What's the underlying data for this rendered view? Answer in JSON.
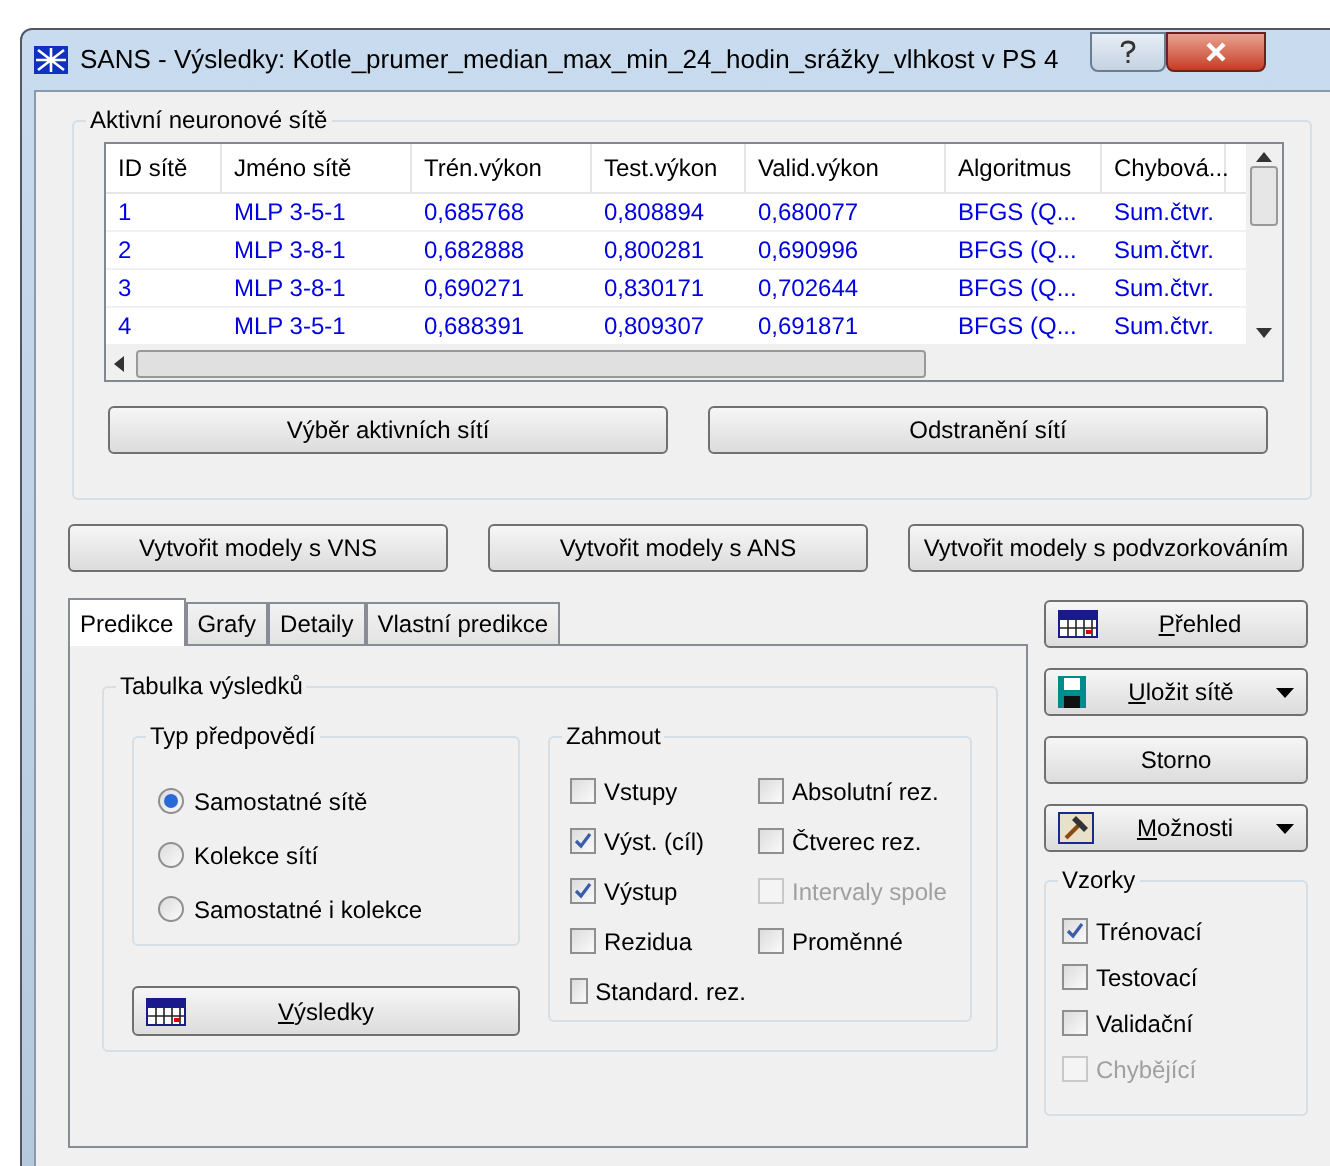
{
  "window": {
    "title": "SANS - Výsledky: Kotle_prumer_median_max_min_24_hodin_srážky_vlhkost v PS 4"
  },
  "networks": {
    "title": "Aktivní neuronové sítě",
    "columns": [
      "ID sítě",
      "Jméno sítě",
      "Trén.výkon",
      "Test.výkon",
      "Valid.výkon",
      "Algoritmus",
      "Chybová..."
    ],
    "rows": [
      [
        "1",
        "MLP 3-5-1",
        "0,685768",
        "0,808894",
        "0,680077",
        "BFGS (Q...",
        "Sum.čtvr."
      ],
      [
        "2",
        "MLP 3-8-1",
        "0,682888",
        "0,800281",
        "0,690996",
        "BFGS (Q...",
        "Sum.čtvr."
      ],
      [
        "3",
        "MLP 3-8-1",
        "0,690271",
        "0,830171",
        "0,702644",
        "BFGS (Q...",
        "Sum.čtvr."
      ],
      [
        "4",
        "MLP 3-5-1",
        "0,688391",
        "0,809307",
        "0,691871",
        "BFGS (Q...",
        "Sum.čtvr."
      ]
    ],
    "buttons": [
      "Výběr aktivních sítí",
      "Odstranění sítí"
    ]
  },
  "model_buttons": [
    "Vytvořit modely s VNS",
    "Vytvořit modely s ANS",
    "Vytvořit modely s podvzorkováním"
  ],
  "tabs": [
    {
      "label": "Predikce",
      "selected": true
    },
    {
      "label": "Grafy",
      "selected": false
    },
    {
      "label": "Detaily",
      "selected": false
    },
    {
      "label": "Vlastní predikce",
      "selected": false
    }
  ],
  "results_table": {
    "title": "Tabulka výsledků",
    "prediction_type": {
      "title": "Typ předpovědí",
      "options": [
        {
          "label": "Samostatné sítě",
          "selected": true
        },
        {
          "label": "Kolekce sítí",
          "selected": false
        },
        {
          "label": "Samostatné i kolekce",
          "selected": false
        }
      ]
    },
    "results_button": "Výsledky",
    "include": {
      "title": "Zahmout",
      "column_1": [
        {
          "label": "Vstupy",
          "checked": false,
          "disabled": false
        },
        {
          "label": "Výst. (cíl)",
          "checked": true,
          "disabled": false
        },
        {
          "label": "Výstup",
          "checked": true,
          "disabled": false
        },
        {
          "label": "Rezidua",
          "checked": false,
          "disabled": false
        },
        {
          "label": "Standard. rez.",
          "checked": false,
          "disabled": false
        }
      ],
      "column_2": [
        {
          "label": "Absolutní rez.",
          "checked": false,
          "disabled": false
        },
        {
          "label": "Čtverec rez.",
          "checked": false,
          "disabled": false
        },
        {
          "label": "Intervaly spole",
          "checked": false,
          "disabled": true
        },
        {
          "label": "Proměnné",
          "checked": false,
          "disabled": false
        }
      ]
    }
  },
  "side_buttons": [
    {
      "label": "Přehled",
      "kind": "summary"
    },
    {
      "label": "Uložit sítě",
      "kind": "save"
    },
    {
      "label": "Storno",
      "kind": "plain"
    },
    {
      "label": "Možnosti",
      "kind": "options"
    }
  ],
  "samples": {
    "title": "Vzorky",
    "items": [
      {
        "label": "Trénovací",
        "checked": true,
        "disabled": false
      },
      {
        "label": "Testovací",
        "checked": false,
        "disabled": false
      },
      {
        "label": "Validační",
        "checked": false,
        "disabled": false
      },
      {
        "label": "Chybějící",
        "checked": false,
        "disabled": true
      }
    ]
  }
}
